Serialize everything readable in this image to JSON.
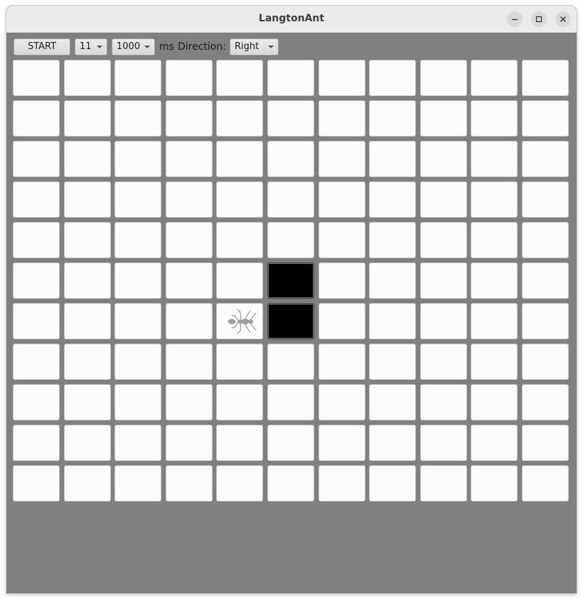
{
  "window": {
    "title": "LangtonAnt",
    "controls": {
      "minimize_icon": "minimize-icon",
      "maximize_icon": "maximize-icon",
      "close_icon": "close-icon"
    }
  },
  "toolbar": {
    "start_label": "START",
    "grid_size_value": "11",
    "delay_value": "1000",
    "delay_unit": "ms",
    "direction_label": "Direction:",
    "direction_value": "Right"
  },
  "grid": {
    "rows": 11,
    "cols": 11,
    "black_cells": [
      [
        5,
        5
      ],
      [
        6,
        5
      ]
    ],
    "ant": {
      "row": 6,
      "col": 4,
      "facing": "right",
      "icon": "ant-icon"
    }
  },
  "colors": {
    "background": "#808080",
    "cell_white": "#fbfbfb",
    "cell_black": "#000000",
    "titlebar": "#ebebeb"
  }
}
